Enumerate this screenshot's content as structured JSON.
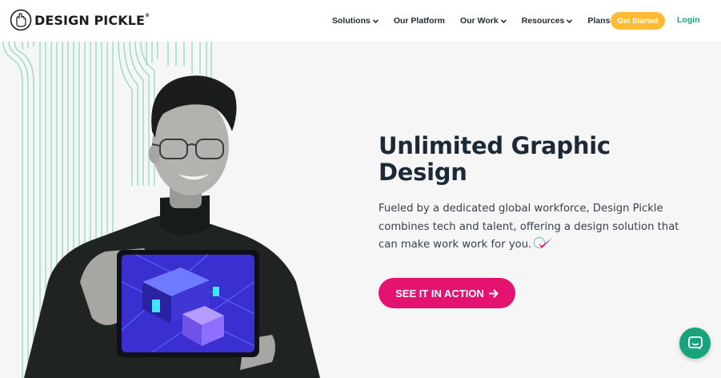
{
  "brand": {
    "name": "DESIGN PICKLE",
    "reg": "®"
  },
  "nav": {
    "items": [
      {
        "label": "Solutions",
        "dropdown": true
      },
      {
        "label": "Our Platform",
        "dropdown": false
      },
      {
        "label": "Our Work",
        "dropdown": true
      },
      {
        "label": "Resources",
        "dropdown": true
      },
      {
        "label": "Plans",
        "dropdown": false
      }
    ],
    "cta_label": "Get Started",
    "login_label": "Login"
  },
  "hero": {
    "headline": "Unlimited Graphic Design",
    "subtext": "Fueled by a dedicated global workforce, Design Pickle combines tech and talent, offering a design solution that can make work work for you.",
    "button_label": "SEE IT IN ACTION",
    "icons": {
      "check": "pickle-checkmark-icon",
      "arrow": "arrow-right-icon",
      "chat": "chat-bubble-icon"
    }
  },
  "colors": {
    "accent_pink": "#e3136f",
    "cta_yellow": "#ffbb34",
    "brand_green": "#14a77f",
    "line_teal": "#8fd9c3",
    "background": "#f6f6f7"
  }
}
